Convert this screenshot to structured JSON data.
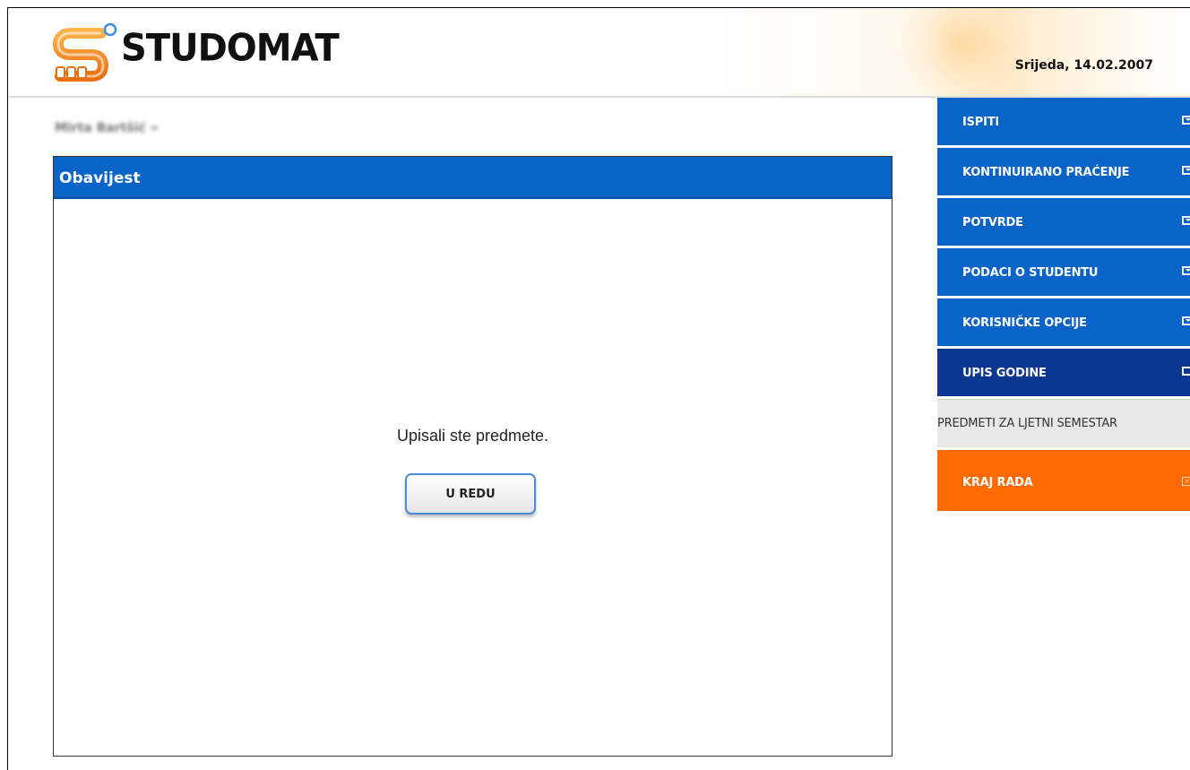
{
  "header": {
    "logo_text": "STUDOMAT",
    "date": "Srijeda, 14.02.2007"
  },
  "breadcrumb": {
    "user": "Mirta Bartšić",
    "separator": "»"
  },
  "dialog": {
    "title": "Obavijest",
    "message": "Upisali ste predmete.",
    "ok_label": "U REDU"
  },
  "menu": {
    "items": [
      {
        "label": "ISPITI",
        "icon": "chevron-down-icon"
      },
      {
        "label": "KONTINUIRANO PRAĆENJE",
        "icon": "chevron-down-icon"
      },
      {
        "label": "POTVRDE",
        "icon": "chevron-down-icon"
      },
      {
        "label": "PODACI O STUDENTU",
        "icon": "chevron-down-icon"
      },
      {
        "label": "KORISNIČKE OPCIJE",
        "icon": "chevron-down-icon"
      },
      {
        "label": "UPIS GODINE",
        "icon": "square-icon"
      }
    ],
    "sub_item": "PREDMETI ZA LJETNI SEMESTAR",
    "exit_label": "KRAJ RADA",
    "exit_icon": "close-box-icon"
  },
  "colors": {
    "menu_blue": "#0a64c8",
    "menu_active": "#0a3690",
    "exit_orange": "#ff6a00",
    "logo_orange": "#f28a1e"
  }
}
